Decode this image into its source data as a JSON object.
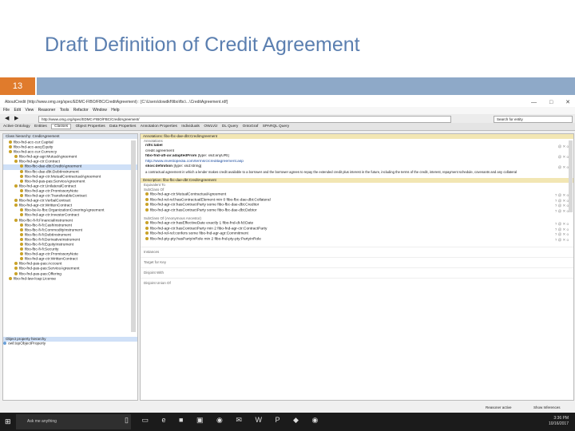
{
  "slide": {
    "title": "Draft Definition of Credit Agreement",
    "number": "13"
  },
  "window": {
    "title": "AboutCredit (http://www.omg.org/spec/EDMC-FIBO/FBC/CreditAgreement) : [C:\\Users\\dowdkf\\fibo\\fbc\\...\\CreditAgreement.rdf]"
  },
  "menu": [
    "File",
    "Edit",
    "View",
    "Reasoner",
    "Tools",
    "Refactor",
    "Window",
    "Help"
  ],
  "address": {
    "value": "http://www.omg.org/spec/EDMC-FIBO/FBC/CreditAgreement/",
    "search_placeholder": "Search for entity"
  },
  "tabs": [
    "Active Ontology",
    "Entities",
    "Classes",
    "Object Properties",
    "Data Properties",
    "Annotation Properties",
    "Individuals",
    "OWLViz",
    "DL Query",
    "OntoGraf",
    "SPARQL Query"
  ],
  "active_tab": "Classes",
  "left_panel": {
    "header": "Class hierarchy: CreditAgreement",
    "tree": [
      "fibo-fnd-acc-cur:Capital",
      "fibo-fnd-acc-aeq:Equity",
      "fibo-fnd-acc-cur:Currency",
      "fibo-fnd-agr-agr:MutualAgreement",
      "fibo-fnd-agr-ctr:Contract",
      "fibo-fbc-dae-dbt:CreditAgreement",
      "fibo-fbc-dae-dbt:DebtInstrument",
      "fibo-fnd-agr-ctr:MutualContractualAgreement",
      "fibo-fnd-pas-pas:ServiceAgreement",
      "fibo-fnd-agr-ctr:UnilateralContract",
      "fibo-fnd-agr-ctr:PromissoryNote",
      "fibo-fnd-agr-ctr:TransferableContract",
      "fibo-fnd-agr-ctr:VerbalContract",
      "fibo-fnd-agr-ctr:WrittenContract",
      "fibo-be-le-fbo:OrganizationCoveringAgreement",
      "fibo-fnd-agr-ctr:InvestorContract",
      "fibo-fbc-fi-fi:FinancialInstrument",
      "fibo-fbc-fi-fi:CashInstrument",
      "fibo-fbc-fi-fi:CommodityInstrument",
      "fibo-fbc-fi-fi:DebtInstrument",
      "fibo-fbc-fi-fi:DerivativeInstrument",
      "fibo-fbc-fi-fi:EquityInstrument",
      "fibo-fbc-fi-fi:Security",
      "fibo-fnd-agr-ctr:PromissoryNote",
      "fibo-fnd-agr-ctr:WrittenContract",
      "fibo-fnd-pas-pas:Account",
      "fibo-fnd-pas-pas:ServiceAgreement",
      "fibo-fnd-pas-pas:Offering",
      "fibo-fnd-law-lcap:License"
    ],
    "selected_index": 5,
    "bottom_header": "Object property hierarchy",
    "bottom_item": "owl:topObjectProperty"
  },
  "annotations": {
    "header": "Annotations: fibo-fbc-dae-dbt:CreditAgreement",
    "section": "Annotations",
    "items": [
      {
        "prop": "rdfs:label",
        "value": "credit agreement"
      },
      {
        "prop": "fibo-fnd-utl-av:adaptedFrom",
        "value": "[type: xsd:anyURI]",
        "link": "http://www.investopedia.com/terms/c/creditagreement.asp"
      },
      {
        "prop": "skos:definition",
        "value": "[type: xsd:string]"
      },
      {
        "prop": "",
        "value": "a contractual agreement in which a lender makes credit available to a borrower and the borrower agrees to repay the extended credit plus interest in the future, including the terms of the credit, interest, repayment schedule, covenants and any collateral"
      }
    ]
  },
  "description": {
    "header": "Description: fibo-fbc-dae-dbt:CreditAgreement",
    "equiv_label": "Equivalent To",
    "subclass_label": "SubClass Of",
    "subclass_items": [
      "fibo-fnd-agr-ctr:MutualContractualAgreement",
      "fibo-fnd-rel-rel:hasContractualElement min 0 fibo-fbc-dae-dbt:Collateral",
      "fibo-fnd-agr-ctr:hasContractParty some fibo-fbc-dae-dbt:Creditor",
      "fibo-fnd-agr-ctr:hasContractParty some fibo-fbc-dae-dbt:Debtor"
    ],
    "anon_label": "SubClass Of (Anonymous Ancestor)",
    "anon_items": [
      "fibo-fnd-agr-ctr:hasEffectiveDate exactly 1 fibo-fnd-dt-fd:Date",
      "fibo-fnd-agr-ctr:hasContractParty min 2 fibo-fnd-agr-ctr:ContractParty",
      "fibo-fnd-rel-rel:confers some fibo-fnd-agr-agr:Commitment",
      "fibo-fnd-pty-pty:hasPartyInRole min 2 fibo-fnd-pty-pty:PartyInRole"
    ],
    "instances_label": "Instances",
    "target_label": "Target for Key",
    "disjoint_label": "Disjoint With",
    "disjoint_union_label": "Disjoint Union Of"
  },
  "statusbar": {
    "reasoner": "Reasoner active",
    "show_inferences": "Show Inferences"
  },
  "taskbar": {
    "search_placeholder": "Ask me anything",
    "time": "3:36 PM",
    "date": "10/16/2017"
  }
}
